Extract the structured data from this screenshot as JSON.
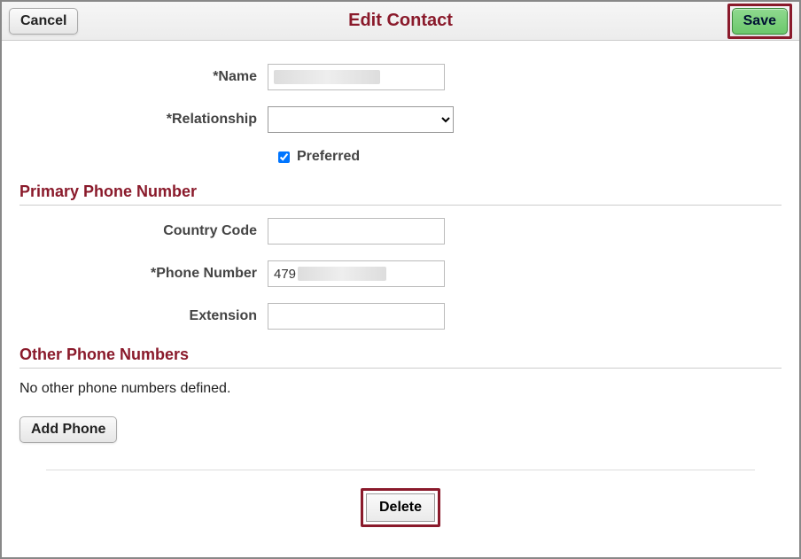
{
  "header": {
    "cancel_label": "Cancel",
    "title": "Edit Contact",
    "save_label": "Save"
  },
  "form": {
    "name_label": "*Name",
    "name_value": "",
    "relationship_label": "*Relationship",
    "relationship_value": "",
    "preferred_label": "Preferred",
    "preferred_checked": true
  },
  "primary": {
    "section_title": "Primary Phone Number",
    "country_code_label": "Country Code",
    "country_code_value": "",
    "phone_label": "*Phone Number",
    "phone_value": "479",
    "extension_label": "Extension",
    "extension_value": ""
  },
  "other": {
    "section_title": "Other Phone Numbers",
    "empty_text": "No other phone numbers defined.",
    "add_phone_label": "Add Phone"
  },
  "footer": {
    "delete_label": "Delete"
  }
}
